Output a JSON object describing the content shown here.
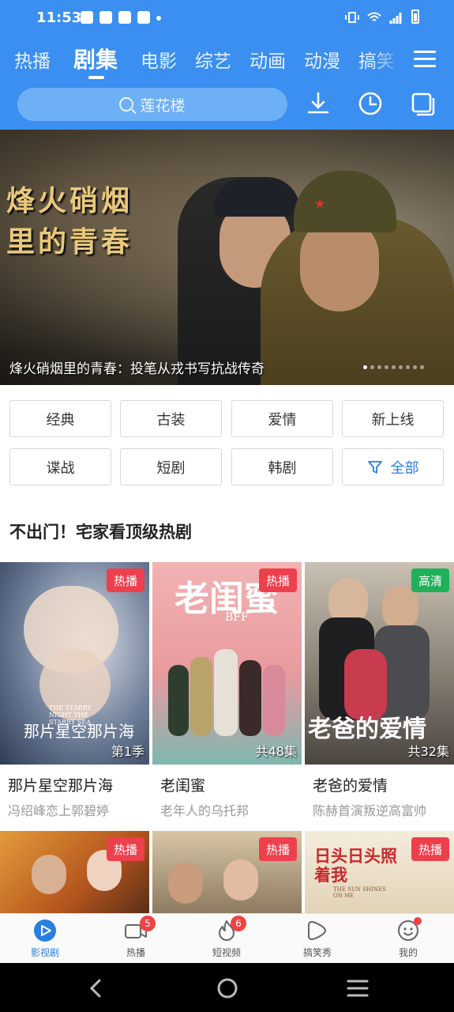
{
  "status_bar": {
    "time": "11:53"
  },
  "header": {
    "tabs": [
      {
        "label": "热播",
        "active": false
      },
      {
        "label": "剧集",
        "active": true
      },
      {
        "label": "电影",
        "active": false
      },
      {
        "label": "综艺",
        "active": false
      },
      {
        "label": "动画",
        "active": false
      },
      {
        "label": "动漫",
        "active": false
      },
      {
        "label": "搞笑",
        "active": false
      }
    ],
    "search_placeholder": "莲花楼",
    "icons": [
      "download-icon",
      "history-icon",
      "copy-icon",
      "menu-icon"
    ]
  },
  "banner": {
    "art_text": "烽火硝烟里的青春",
    "caption": "烽火硝烟里的青春：投笔从戎书写抗战传奇",
    "dots_total": 9,
    "dots_active": 0
  },
  "categories": [
    {
      "label": "经典"
    },
    {
      "label": "古装"
    },
    {
      "label": "爱情"
    },
    {
      "label": "新上线"
    },
    {
      "label": "谍战"
    },
    {
      "label": "短剧"
    },
    {
      "label": "韩剧"
    },
    {
      "label": "全部"
    }
  ],
  "section": {
    "title": "不出门！宅家看顶级热剧",
    "cards": [
      {
        "title": "那片星空那片海",
        "subtitle": "冯绍峰恋上郭碧婷",
        "badge": "热播",
        "episode": "第1季",
        "poster_text": "那片星空那片海",
        "poster_en": "THE STARRY NIGHT THE STARRY SEA",
        "color": "#3a4f6e"
      },
      {
        "title": "老闺蜜",
        "subtitle": "老年人的乌托邦",
        "badge": "热播",
        "episode": "共48集",
        "poster_text": "老闺蜜",
        "poster_en": "BFF",
        "color": "#e7a6a6"
      },
      {
        "title": "老爸的爱情",
        "subtitle": "陈赫首演叛逆高富帅",
        "badge": "高清",
        "episode": "共32集",
        "poster_text": "老爸的爱情",
        "poster_en": "",
        "color": "#7a6a60"
      }
    ],
    "cards_row2": [
      {
        "badge": "热播",
        "color": "#c7702a"
      },
      {
        "badge": "热播",
        "color": "#b9a184"
      },
      {
        "badge": "热播",
        "color": "#e9dcc6",
        "poster_text": "日头日头照着我",
        "poster_en": "THE SUN SHINES ON ME"
      }
    ]
  },
  "bottom_nav": [
    {
      "label": "影视剧",
      "icon": "play-circle-icon",
      "active": true
    },
    {
      "label": "热播",
      "icon": "video-icon",
      "badge": "5"
    },
    {
      "label": "短视频",
      "icon": "flame-icon",
      "badge": "6"
    },
    {
      "label": "搞笑秀",
      "icon": "play-bubble-icon"
    },
    {
      "label": "我的",
      "icon": "smile-icon",
      "dot": true
    }
  ],
  "colors": {
    "primary": "#3a8ff0",
    "badge_red": "#ee3f4d",
    "badge_green": "#21b05a",
    "accent_blue": "#2a7de1"
  }
}
